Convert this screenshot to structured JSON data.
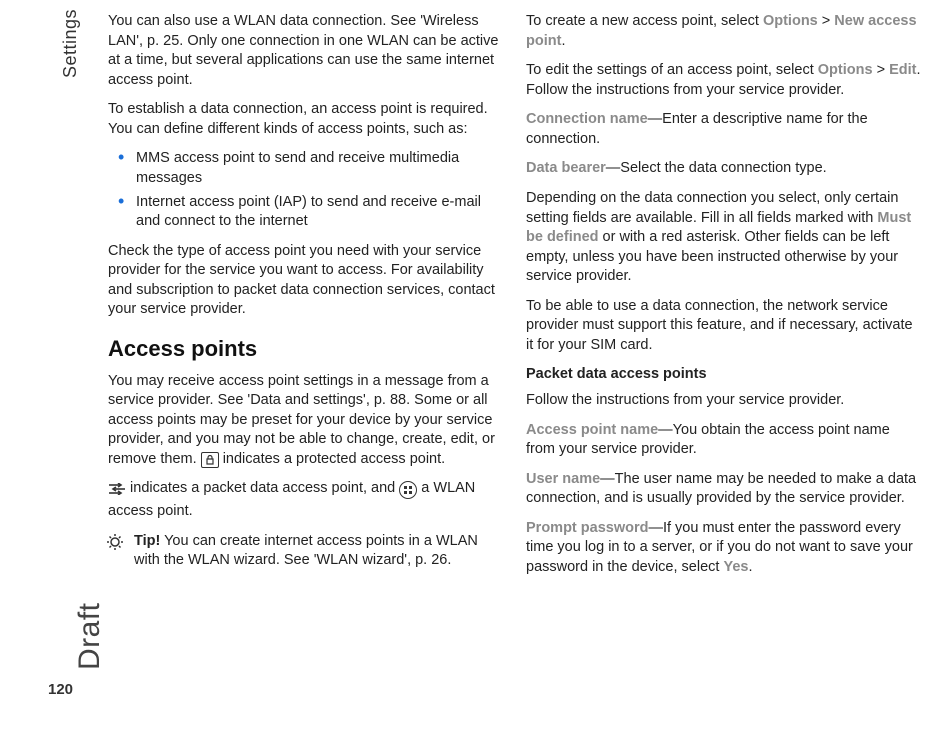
{
  "sidebar": {
    "section": "Settings",
    "draft": "Draft",
    "page_number": "120"
  },
  "col1": {
    "p1": "You can also use a WLAN data connection. See 'Wireless LAN', p. 25. Only one connection in one WLAN can be active at a time, but several applications can use the same internet access point.",
    "p2": "To establish a data connection, an access point is required. You can define different kinds of access points, such as:",
    "bullets": [
      "MMS access point to send and receive multimedia messages",
      "Internet access point (IAP) to send and receive e-mail and connect to the internet"
    ],
    "p3": "Check the type of access point you need with your service provider for the service you want to access. For availability and subscription to packet data connection services, contact your service provider.",
    "h2": "Access points",
    "p4_a": "You may receive access point settings in a message from a service provider. See 'Data and settings', p. 88. Some or all access points may be preset for your device by your service provider, and you may not be able to change, create, edit, or remove them. ",
    "p4_b": " indicates a protected access point.",
    "p5_a": " indicates a packet data access point, and ",
    "p5_b": " a WLAN access point.",
    "tip_label": "Tip!",
    "tip_text": " You can create internet access points in a WLAN with the WLAN wizard. See 'WLAN wizard', p. 26."
  },
  "col2": {
    "p1_a": "To create a new access point, select ",
    "p1_opt": "Options",
    "p1_gt": " > ",
    "p1_nap": "New access point",
    "p1_end": ".",
    "p2_a": "To edit the settings of an access point, select ",
    "p2_opt": "Options",
    "p2_gt": " > ",
    "p2_edit": "Edit",
    "p2_end": ". Follow the instructions from your service provider.",
    "p3_label": "Connection name",
    "p3_text": "—Enter a descriptive name for the connection.",
    "p4_label": "Data bearer",
    "p4_text": "—Select the data connection type.",
    "p5_a": "Depending on the data connection you select, only certain setting fields are available. Fill in all fields marked with ",
    "p5_mbd": "Must be defined",
    "p5_b": " or with a red asterisk. Other fields can be left empty, unless you have been instructed otherwise by your service provider.",
    "p6": "To be able to use a data connection, the network service provider must support this feature, and if necessary, activate it for your SIM card.",
    "subhead": "Packet data access points",
    "p7": "Follow the instructions from your service provider.",
    "p8_label": "Access point name",
    "p8_text": "—You obtain the access point name from your service provider.",
    "p9_label": "User name",
    "p9_text": "—The user name may be needed to make a data connection, and is usually provided by the service provider.",
    "p10_label": "Prompt password",
    "p10_a": "—If you must enter the password every time you log in to a server, or if you do not want to save your password in the device, select ",
    "p10_yes": "Yes",
    "p10_end": "."
  }
}
